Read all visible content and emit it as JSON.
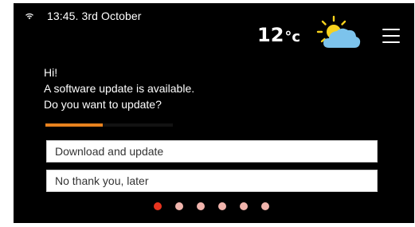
{
  "status_bar": {
    "wifi_icon": "wifi-icon",
    "datetime": "13:45. 3rd October"
  },
  "weather": {
    "temperature": "12",
    "unit": "°c",
    "icon": "partly-cloudy-icon"
  },
  "menu_icon": "hamburger-menu-icon",
  "message": {
    "greeting": "Hi!",
    "line1": "A software update is available.",
    "line2": "Do you want to update?"
  },
  "progress": {
    "fraction": 0.45
  },
  "options": [
    {
      "label": "Download and update"
    },
    {
      "label": "No thank you, later"
    }
  ],
  "pagination": {
    "count": 6,
    "active_index": 0
  },
  "colors": {
    "background": "#000000",
    "accent_orange": "#e8821e",
    "active_dot": "#e8341f",
    "inactive_dot": "#f0b4ac",
    "sun": "#f7d21d",
    "cloud": "#7cc3ec"
  }
}
